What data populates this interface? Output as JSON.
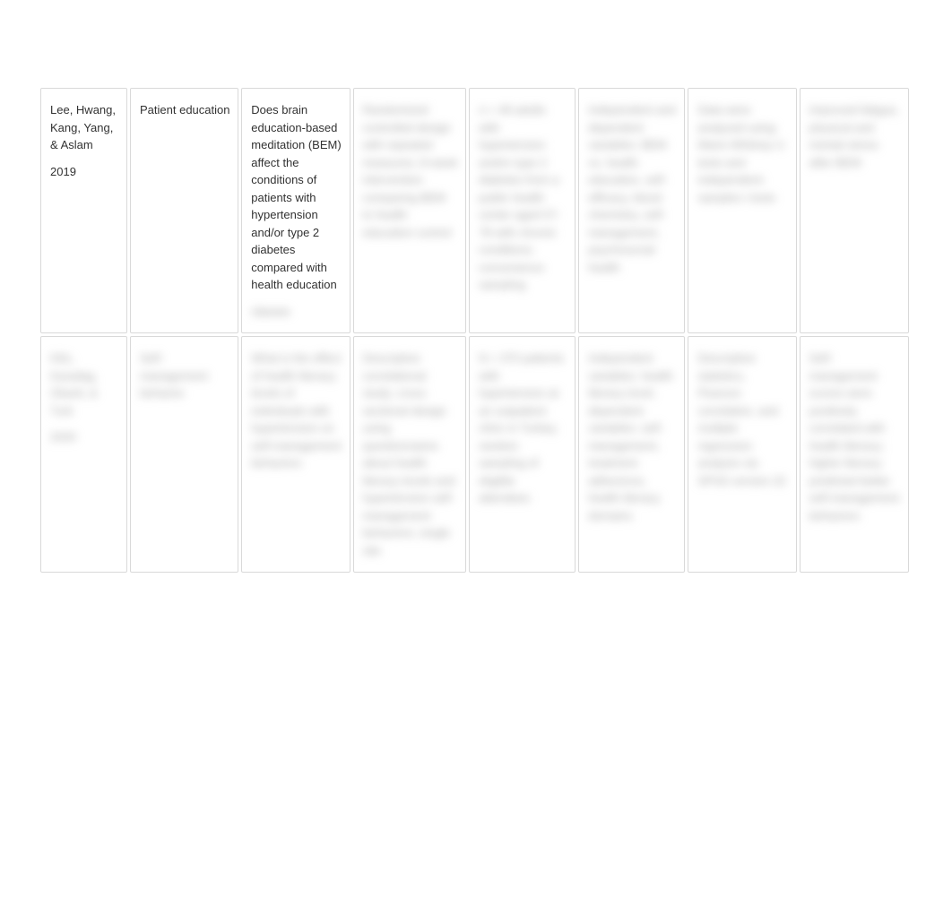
{
  "rows": [
    {
      "c1_authors": "Lee, Hwang, Kang, Yang, & Aslam",
      "c1_year": "2019",
      "c2": "Patient education",
      "c3_clear": "Does brain education-based meditation (BEM) affect the conditions of patients with hypertension and/or type 2 diabetes compared with health education",
      "c3_blur": "classes",
      "c4": "Randomized controlled design with repeated measures; 8-week intervention comparing BEM to health education control",
      "c5": "n = 48 adults with hypertension and/or type 2 diabetes from a public health center aged 57-78 with chronic conditions; convenience sampling",
      "c6": "Independent and dependent variables: BEM vs. health education, self-efficacy, blood chemistry, self-management, psychosocial health",
      "c7": "Data were analyzed using Mann-Whitney U tests and independent-samples t tests",
      "c8": "Improved fatigue, physical and mental stress after BEM",
      "row_key": "row1"
    },
    {
      "c1_authors": "Kilic, Karadag, Okanli, & Turk",
      "c1_year": "2020",
      "c2": "Self-management behavior",
      "c3_clear": "What is the effect of health literacy levels of individuals with hypertension on self-management behaviors",
      "c3_blur": "",
      "c4": "Descriptive correlational study; cross-sectional design using questionnaires about health literacy levels and hypertension self-management behaviors; single site",
      "c5": "N = 370 patients with hypertension at an outpatient clinic in Turkey; random sampling of eligible attendees",
      "c6": "Independent variables: health literacy level; dependent variables: self-management, treatment adherence, health literacy domains",
      "c7": "Descriptive statistics, Pearson correlation, and multiple regression analysis via SPSS version 22",
      "c8": "Self-management scores were positively correlated with health literacy; higher literacy predicted better self-management behaviors",
      "row_key": "row2"
    }
  ]
}
